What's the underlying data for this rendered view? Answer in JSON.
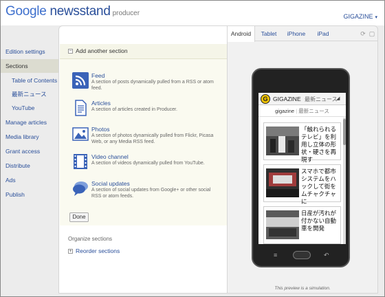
{
  "header": {
    "logo_google": "Google",
    "logo_newsstand": "newsstand",
    "logo_producer": "producer",
    "account_label": "GIGAZINE",
    "account_caret": "▾"
  },
  "sidebar": {
    "items": [
      {
        "label": "Edition settings"
      },
      {
        "label": "Sections"
      },
      {
        "label": "Table of Contents"
      },
      {
        "label": "最新ニュース"
      },
      {
        "label": "YouTube"
      },
      {
        "label": "Manage articles"
      },
      {
        "label": "Media library"
      },
      {
        "label": "Grant access"
      },
      {
        "label": "Distribute"
      },
      {
        "label": "Ads"
      },
      {
        "label": "Publish"
      }
    ]
  },
  "main": {
    "add_section_label": "Add another section",
    "section_types": [
      {
        "title": "Feed",
        "desc": "A section of posts dynamically pulled from a RSS or atom feed.",
        "icon": "rss-icon",
        "color": "#3a63b8"
      },
      {
        "title": "Articles",
        "desc": "A section of articles created in Producer.",
        "icon": "document-icon",
        "color": "#3a63b8"
      },
      {
        "title": "Photos",
        "desc": "A section of photos dynamically pulled from Flickr, Picasa Web, or any Media RSS feed.",
        "icon": "photo-icon",
        "color": "#3a63b8"
      },
      {
        "title": "Video channel",
        "desc": "A section of videos dynamically pulled from YouTube.",
        "icon": "film-icon",
        "color": "#3a63b8"
      },
      {
        "title": "Social updates",
        "desc": "A section of social updates from Google+ or other social RSS or atom feeds.",
        "icon": "speech-bubble-icon",
        "color": "#3a63b8"
      }
    ],
    "done_label": "Done",
    "organize_label": "Organize sections",
    "reorder_label": "Reorder sections"
  },
  "preview": {
    "tabs": [
      {
        "label": "Android",
        "active": true
      },
      {
        "label": "Tablet",
        "active": false
      },
      {
        "label": "iPhone",
        "active": false
      },
      {
        "label": "iPad",
        "active": false
      }
    ],
    "caption": "This preview is a simulation.",
    "phone": {
      "app_logo_letter": "G",
      "app_name": "GIGAZINE",
      "section_name": "最新ニュース",
      "section_caret": "◢",
      "breadcrumb_edition": "gigazine",
      "breadcrumb_sep": "|",
      "breadcrumb_section": "最新ニュース",
      "stories": [
        {
          "text": "「触れられるテレビ」を利用し立体の形状・硬さを再現す"
        },
        {
          "text": "スマホで都市システムをハックして街をムチャクチャに"
        },
        {
          "text": "日産が汚れが付かない自動車を開発"
        }
      ]
    }
  },
  "colors": {
    "accent": "#2a4f9a",
    "panel_bg": "#fafaf0",
    "active_nav_bg": "#dcdcd0"
  }
}
